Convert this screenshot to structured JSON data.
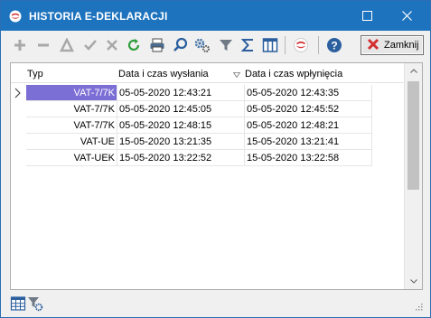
{
  "window": {
    "title": "HISTORIA E-DEKLARACJI",
    "accent_color": "#1e73be"
  },
  "toolbar": {
    "buttons": [
      {
        "name": "add",
        "icon": "plus-icon"
      },
      {
        "name": "delete",
        "icon": "minus-icon"
      },
      {
        "name": "edit",
        "icon": "triangle-icon"
      },
      {
        "name": "accept",
        "icon": "check-icon"
      },
      {
        "name": "cancel",
        "icon": "x-icon"
      },
      {
        "name": "refresh",
        "icon": "refresh-icon"
      },
      {
        "name": "print",
        "icon": "printer-icon"
      },
      {
        "name": "search",
        "icon": "search-icon"
      },
      {
        "name": "settings",
        "icon": "gears-icon"
      },
      {
        "name": "filter",
        "icon": "filter-icon"
      },
      {
        "name": "sum",
        "icon": "sigma-icon"
      },
      {
        "name": "columns",
        "icon": "columns-icon"
      },
      {
        "name": "edeklaracje",
        "icon": "app-logo-icon"
      },
      {
        "name": "help",
        "icon": "help-icon"
      }
    ],
    "close_label": "Zamknij"
  },
  "grid": {
    "columns": [
      "Typ",
      "Data i czas wysłania",
      "Data i czas wpłynięcia"
    ],
    "sorted_column": "Data i czas wpłynięcia",
    "rows": [
      {
        "typ": "VAT-7/7K",
        "wyslania": "05-05-2020 12:43:21",
        "wplyniecia": "05-05-2020 12:43:35",
        "selected": true
      },
      {
        "typ": "VAT-7/7K",
        "wyslania": "05-05-2020 12:45:05",
        "wplyniecia": "05-05-2020 12:45:52",
        "selected": false
      },
      {
        "typ": "VAT-7/7K",
        "wyslania": "05-05-2020 12:48:15",
        "wplyniecia": "05-05-2020 12:48:21",
        "selected": false
      },
      {
        "typ": "VAT-UE",
        "wyslania": "15-05-2020 13:21:35",
        "wplyniecia": "15-05-2020 13:21:41",
        "selected": false
      },
      {
        "typ": "VAT-UEK",
        "wyslania": "15-05-2020 13:22:52",
        "wplyniecia": "15-05-2020 13:22:58",
        "selected": false
      }
    ],
    "selection_color": "#7b6fd6"
  },
  "statusbar": {
    "icons": [
      "grid-view-icon",
      "filter-settings-icon"
    ]
  }
}
